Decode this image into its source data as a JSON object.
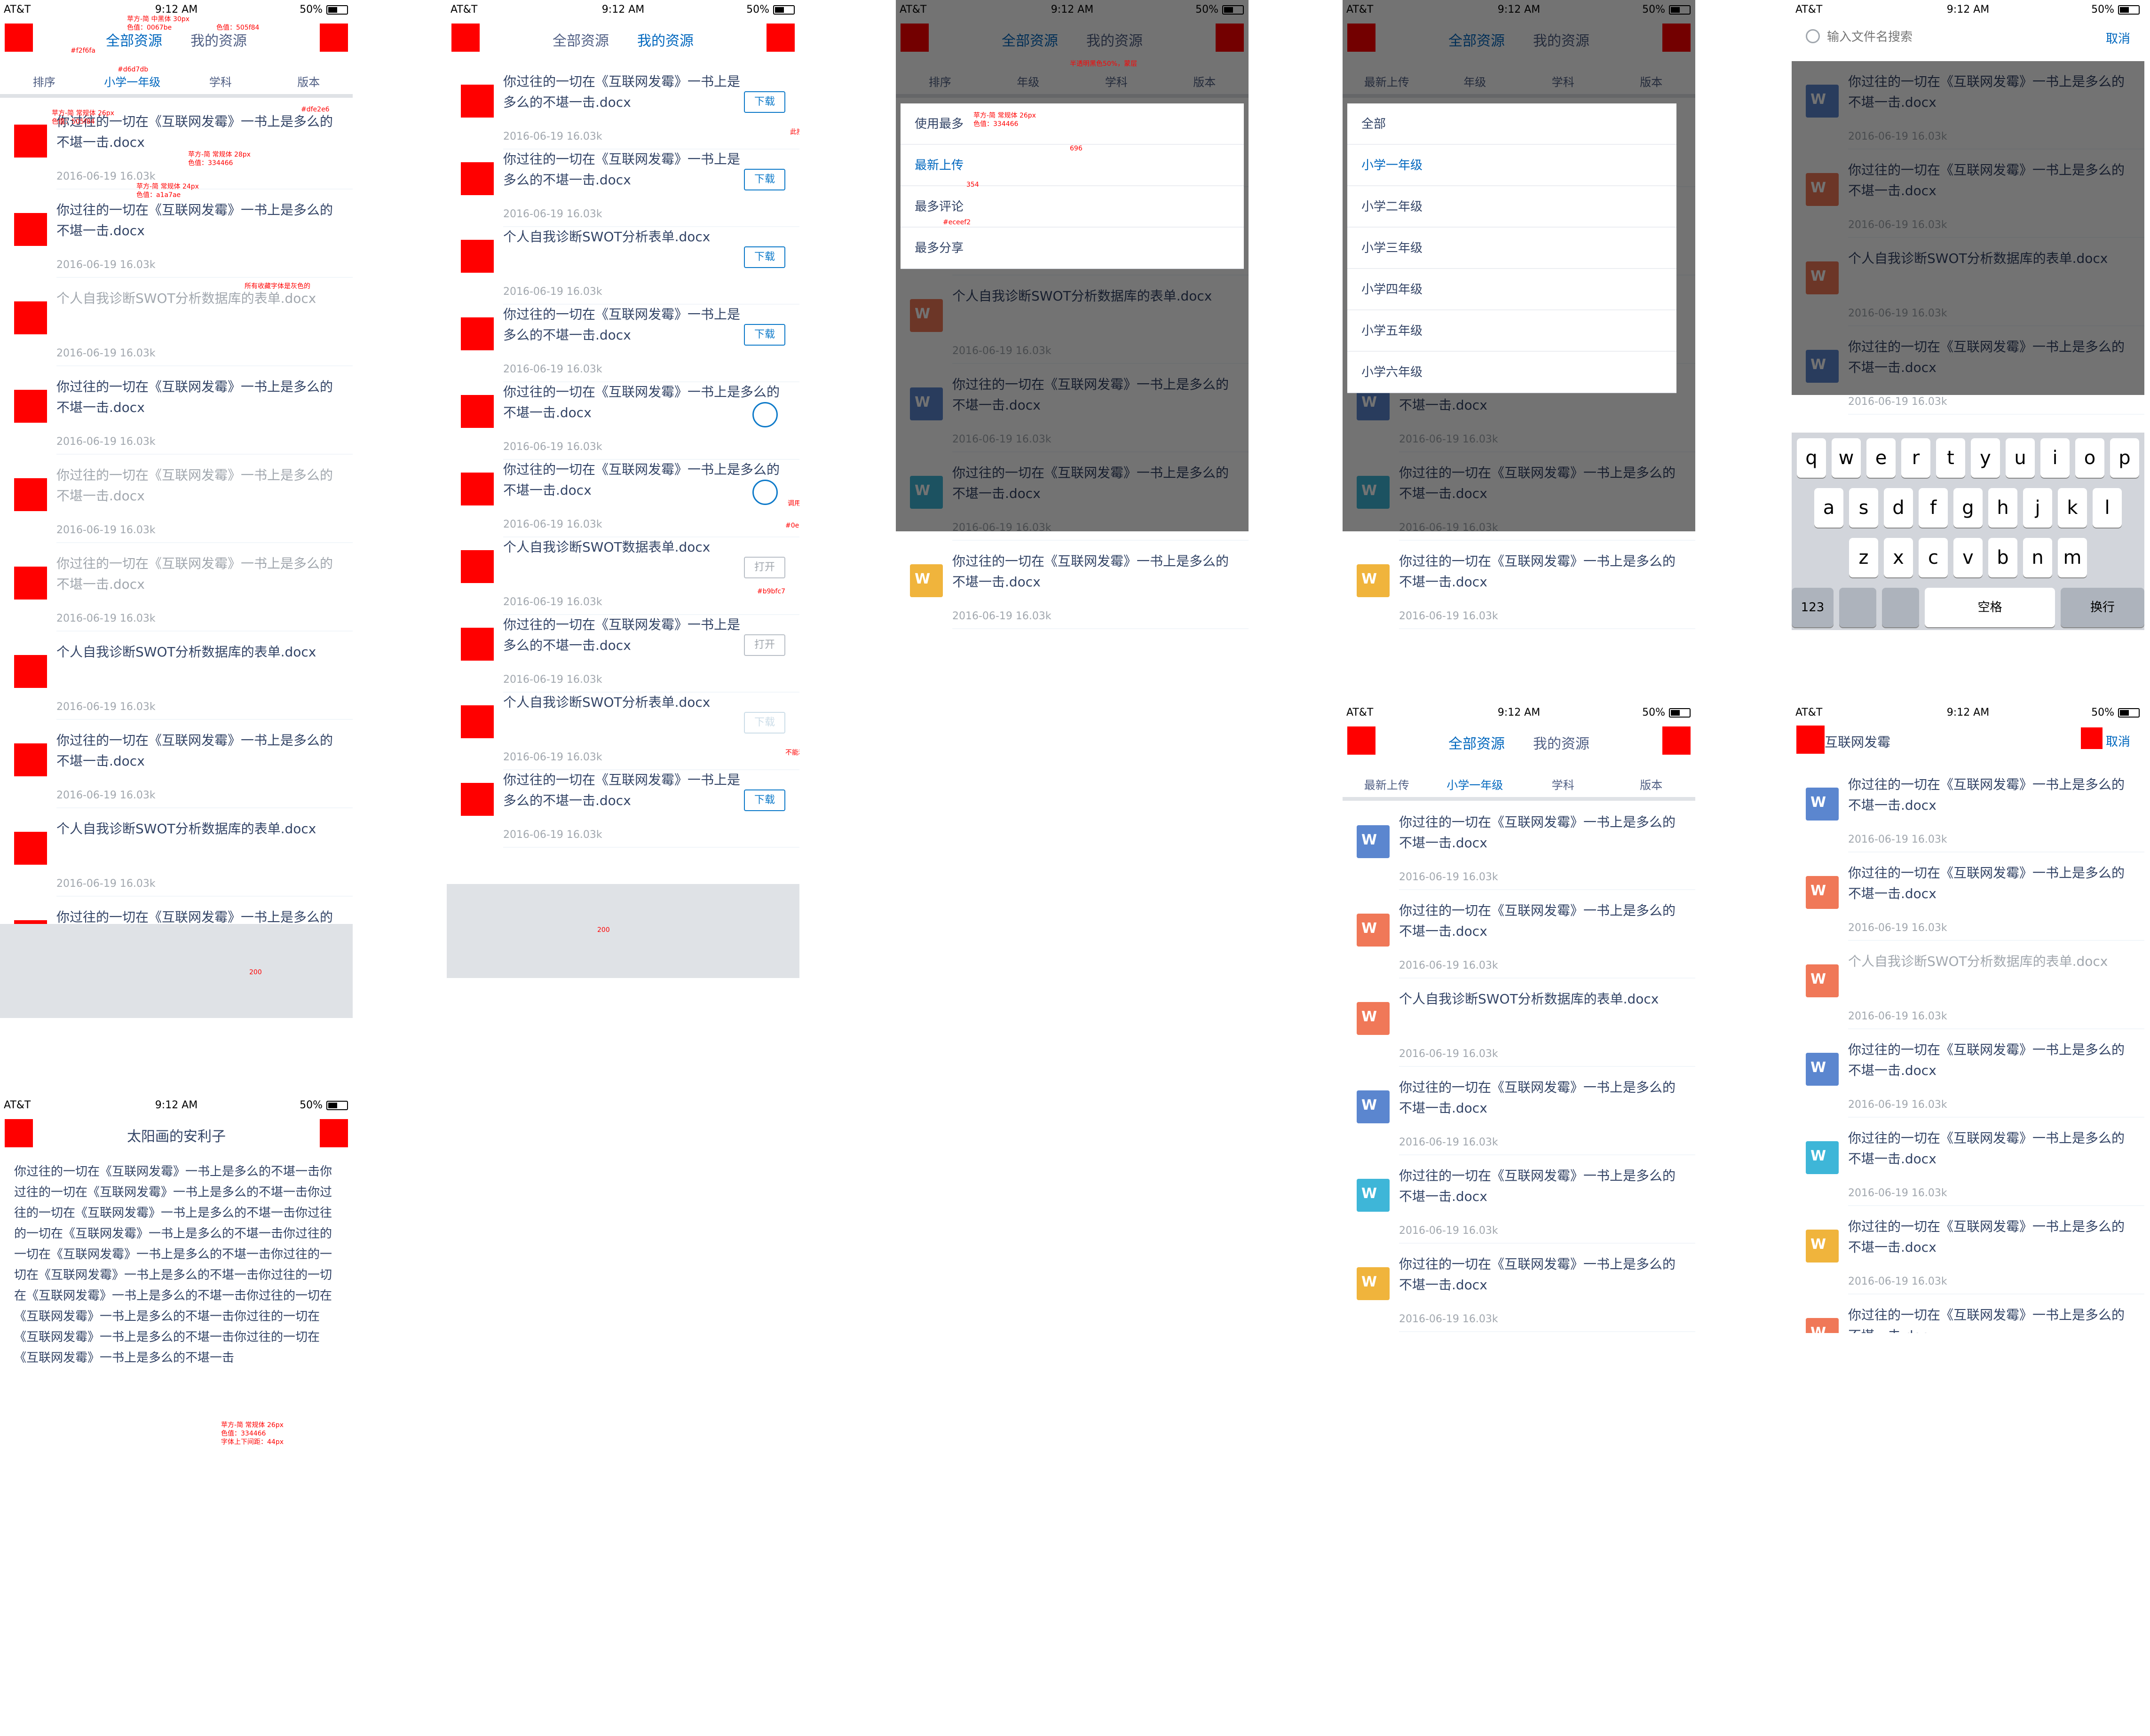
{
  "status": {
    "carrier": "AT&T",
    "time": "9:12 AM",
    "battery": "50%"
  },
  "nav": {
    "tab_all": "全部资源",
    "tab_mine": "我的资源"
  },
  "filters": {
    "sort": "排序",
    "grade": "年级",
    "grade_selected": "小学一年级",
    "subject": "学科",
    "version": "版本",
    "newest": "最新上传"
  },
  "files": {
    "long": "你过往的一切在《互联网发霉》一书上是多么的不堪一击.docx",
    "swot_db": "个人自我诊断SWOT分析数据库的表单.docx",
    "swot_data": "个人自我诊断SWOT数据表单.docx",
    "swot_form": "个人自我诊断SWOT分析表单.docx",
    "date": "2016-06-19",
    "size": "16.03k"
  },
  "buttons": {
    "download": "下载",
    "open": "打开",
    "cancel": "取消"
  },
  "sort_menu": [
    "使用最多",
    "最新上传",
    "最多评论",
    "最多分享"
  ],
  "grade_menu": [
    "全部",
    "小学一年级",
    "小学二年级",
    "小学三年级",
    "小学四年级",
    "小学五年级",
    "小学六年级"
  ],
  "search": {
    "placeholder": "输入文件名搜索",
    "query": "互联网发霉"
  },
  "keyboard": {
    "row1": [
      "q",
      "w",
      "e",
      "r",
      "t",
      "y",
      "u",
      "i",
      "o",
      "p"
    ],
    "row2": [
      "a",
      "s",
      "d",
      "f",
      "g",
      "h",
      "j",
      "k",
      "l"
    ],
    "row3": [
      "z",
      "x",
      "c",
      "v",
      "b",
      "n",
      "m"
    ],
    "num": "123",
    "space": "空格",
    "enter": "换行"
  },
  "article": {
    "title": "太阳画的安利子",
    "body": "你过往的一切在《互联网发霉》一书上是多么的不堪一击你过往的一切在《互联网发霉》一书上是多么的不堪一击你过往的一切在《互联网发霉》一书上是多么的不堪一击你过往的一切在《互联网发霉》一书上是多么的不堪一击你过往的一切在《互联网发霉》一书上是多么的不堪一击你过往的一切在《互联网发霉》一书上是多么的不堪一击你过往的一切在《互联网发霉》一书上是多么的不堪一击你过往的一切在《互联网发霉》一书上是多么的不堪一击你过往的一切在《互联网发霉》一书上是多么的不堪一击你过往的一切在《互联网发霉》一书上是多么的不堪一击"
  },
  "annotations": {
    "font_30": "苹方-简 中黑体 30px",
    "color_0067be": "色值：0067be",
    "color_505f84": "色值：505f84",
    "font_26": "苹方-简 常规体 26px",
    "font_28": "苹方-简 常规体 28px",
    "font_24": "苹方-简 常规体 24px",
    "color_334466": "色值：334466",
    "color_a1a7ae": "色值：a1a7ae",
    "line_44": "字体上下间距：44px",
    "icon_note": "左右icon大小复用整个板块",
    "fav_grey": "所有收藏字体是灰色的",
    "call_system": "调用系统",
    "btn_size": "此按钮尺寸 88x46px，圆角弧度4px，粗细2px，色值：0e7ac9",
    "no_download": "不能和下载颜色：#ccdde8",
    "hex_f2f6fa": "#f2f6fa",
    "hex_d6d7db": "#d6d7db",
    "hex_dfe2e6": "#dfe2e6",
    "hex_0e7ac9": "#0e7ac9",
    "hex_b9bfc7": "#b9bfc7",
    "hex_eceef2": "#eceef2",
    "hex_0067be": "0067be",
    "mask": "半透明黑色50%，蒙层",
    "num_200": "200",
    "num_696": "696",
    "num_354": "354"
  }
}
